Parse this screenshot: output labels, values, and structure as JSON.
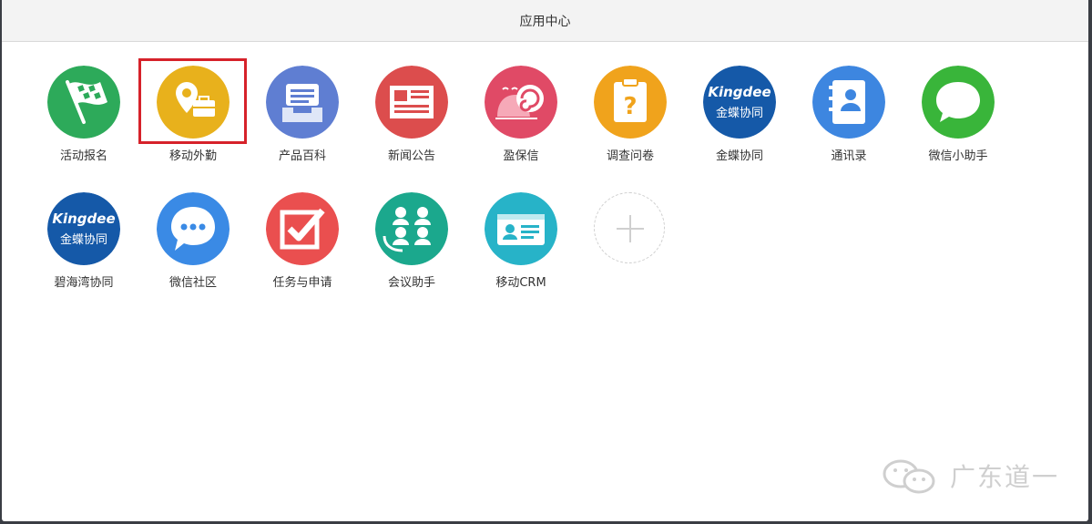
{
  "window": {
    "title": "应用中心"
  },
  "apps": [
    {
      "label": "活动报名",
      "icon": "flag-icon",
      "color": "#2daa5a"
    },
    {
      "label": "移动外勤",
      "icon": "location-briefcase-icon",
      "color": "#e8b11c",
      "selected": true
    },
    {
      "label": "产品百科",
      "icon": "archive-tray-icon",
      "color": "#5f7ed2"
    },
    {
      "label": "新闻公告",
      "icon": "newspaper-icon",
      "color": "#dc4d4d"
    },
    {
      "label": "盈保信",
      "icon": "snail-mascot-icon",
      "color": "#e04a66"
    },
    {
      "label": "调查问卷",
      "icon": "clipboard-question-icon",
      "color": "#f0a31c"
    },
    {
      "label": "金蝶协同",
      "icon": "kingdee-logo-icon",
      "color": "#1559a8"
    },
    {
      "label": "通讯录",
      "icon": "contacts-book-icon",
      "color": "#3d86e0"
    },
    {
      "label": "微信小助手",
      "icon": "chat-bubble-icon",
      "color": "#39b53a"
    },
    {
      "label": "碧海湾协同",
      "icon": "kingdee-logo-icon",
      "color": "#1559a8"
    },
    {
      "label": "微信社区",
      "icon": "speech-dots-icon",
      "color": "#3a8ae5"
    },
    {
      "label": "任务与申请",
      "icon": "checkbox-icon",
      "color": "#ea4f4f"
    },
    {
      "label": "会议助手",
      "icon": "meeting-people-icon",
      "color": "#1ba88d"
    },
    {
      "label": "移动CRM",
      "icon": "id-card-icon",
      "color": "#27b3c8"
    }
  ],
  "add_button": {
    "icon": "plus-icon"
  },
  "kingdee_logo": {
    "brand": "Kingdee",
    "cn": "金蝶协同"
  },
  "watermark": {
    "text": "广东道一",
    "icon": "wechat-icon"
  }
}
